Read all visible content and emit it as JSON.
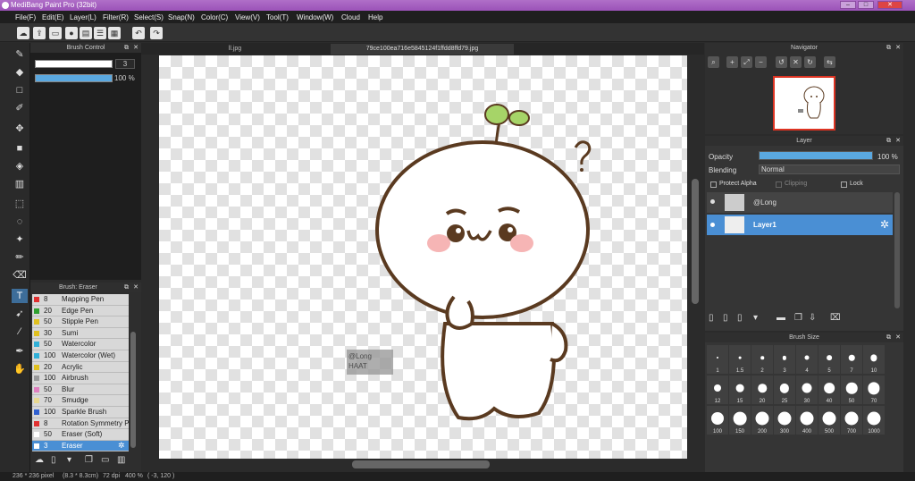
{
  "window": {
    "title": "MediBang Paint Pro (32bit)"
  },
  "menu": [
    "File(F)",
    "Edit(E)",
    "Layer(L)",
    "Filter(R)",
    "Select(S)",
    "Snap(N)",
    "Color(C)",
    "View(V)",
    "Tool(T)",
    "Window(W)",
    "Cloud",
    "Help"
  ],
  "brush_control": {
    "title": "Brush Control",
    "size_value": "3",
    "opacity_value": "100 %"
  },
  "brush_list": {
    "title": "Brush: Eraser",
    "items": [
      {
        "size": "8",
        "name": "Mapping Pen",
        "color": "#e03030"
      },
      {
        "size": "20",
        "name": "Edge Pen",
        "color": "#30a030"
      },
      {
        "size": "50",
        "name": "Stipple Pen",
        "color": "#e0c020"
      },
      {
        "size": "30",
        "name": "Sumi",
        "color": "#e0c020"
      },
      {
        "size": "50",
        "name": "Watercolor",
        "color": "#30b0d8"
      },
      {
        "size": "100",
        "name": "Watercolor (Wet)",
        "color": "#30b0d8"
      },
      {
        "size": "20",
        "name": "Acrylic",
        "color": "#e0c020"
      },
      {
        "size": "100",
        "name": "Airbrush",
        "color": "#999999"
      },
      {
        "size": "50",
        "name": "Blur",
        "color": "#e080c0"
      },
      {
        "size": "70",
        "name": "Smudge",
        "color": "#e8d890"
      },
      {
        "size": "100",
        "name": "Sparkle Brush",
        "color": "#3060d0"
      },
      {
        "size": "8",
        "name": "Rotation Symmetry Pe",
        "color": "#e03030"
      },
      {
        "size": "50",
        "name": "Eraser (Soft)",
        "color": "#ffffff"
      },
      {
        "size": "3",
        "name": "Eraser",
        "color": "#ffffff"
      }
    ],
    "selected_index": 13
  },
  "tabs": [
    {
      "label": "ll.jpg",
      "active": false
    },
    {
      "label": "79ce100ea716e5845124f1ffdd8ffd79.jpg",
      "active": true
    }
  ],
  "canvas": {
    "watermark_line1": "@Long",
    "watermark_line2": "HAAT"
  },
  "navigator": {
    "title": "Navigator"
  },
  "layer": {
    "title": "Layer",
    "opacity_label": "Opacity",
    "opacity_value": "100 %",
    "opacity_fraction": 1.0,
    "blending_label": "Blending",
    "blending_value": "Normal",
    "protect_alpha": "Protect Alpha",
    "clipping": "Clipping",
    "lock": "Lock",
    "layers": [
      {
        "name": "@Long",
        "selected": false
      },
      {
        "name": "Layer1",
        "selected": true
      }
    ]
  },
  "brush_size": {
    "title": "Brush Size",
    "sizes": [
      "1",
      "1.5",
      "2",
      "3",
      "4",
      "5",
      "7",
      "10",
      "12",
      "15",
      "20",
      "25",
      "30",
      "40",
      "50",
      "70",
      "100",
      "150",
      "200",
      "300",
      "400",
      "500",
      "700",
      "1000"
    ]
  },
  "status": {
    "dimensions": "236 * 236 pixel",
    "physical": "(8.3 * 8.3cm)",
    "dpi": "72 dpi",
    "zoom": "400 %",
    "coords": "( -3, 120 )"
  },
  "colors": {
    "accent": "#4a8fd4",
    "title_bar": "#a45cbf",
    "panel_bg": "#353535"
  }
}
